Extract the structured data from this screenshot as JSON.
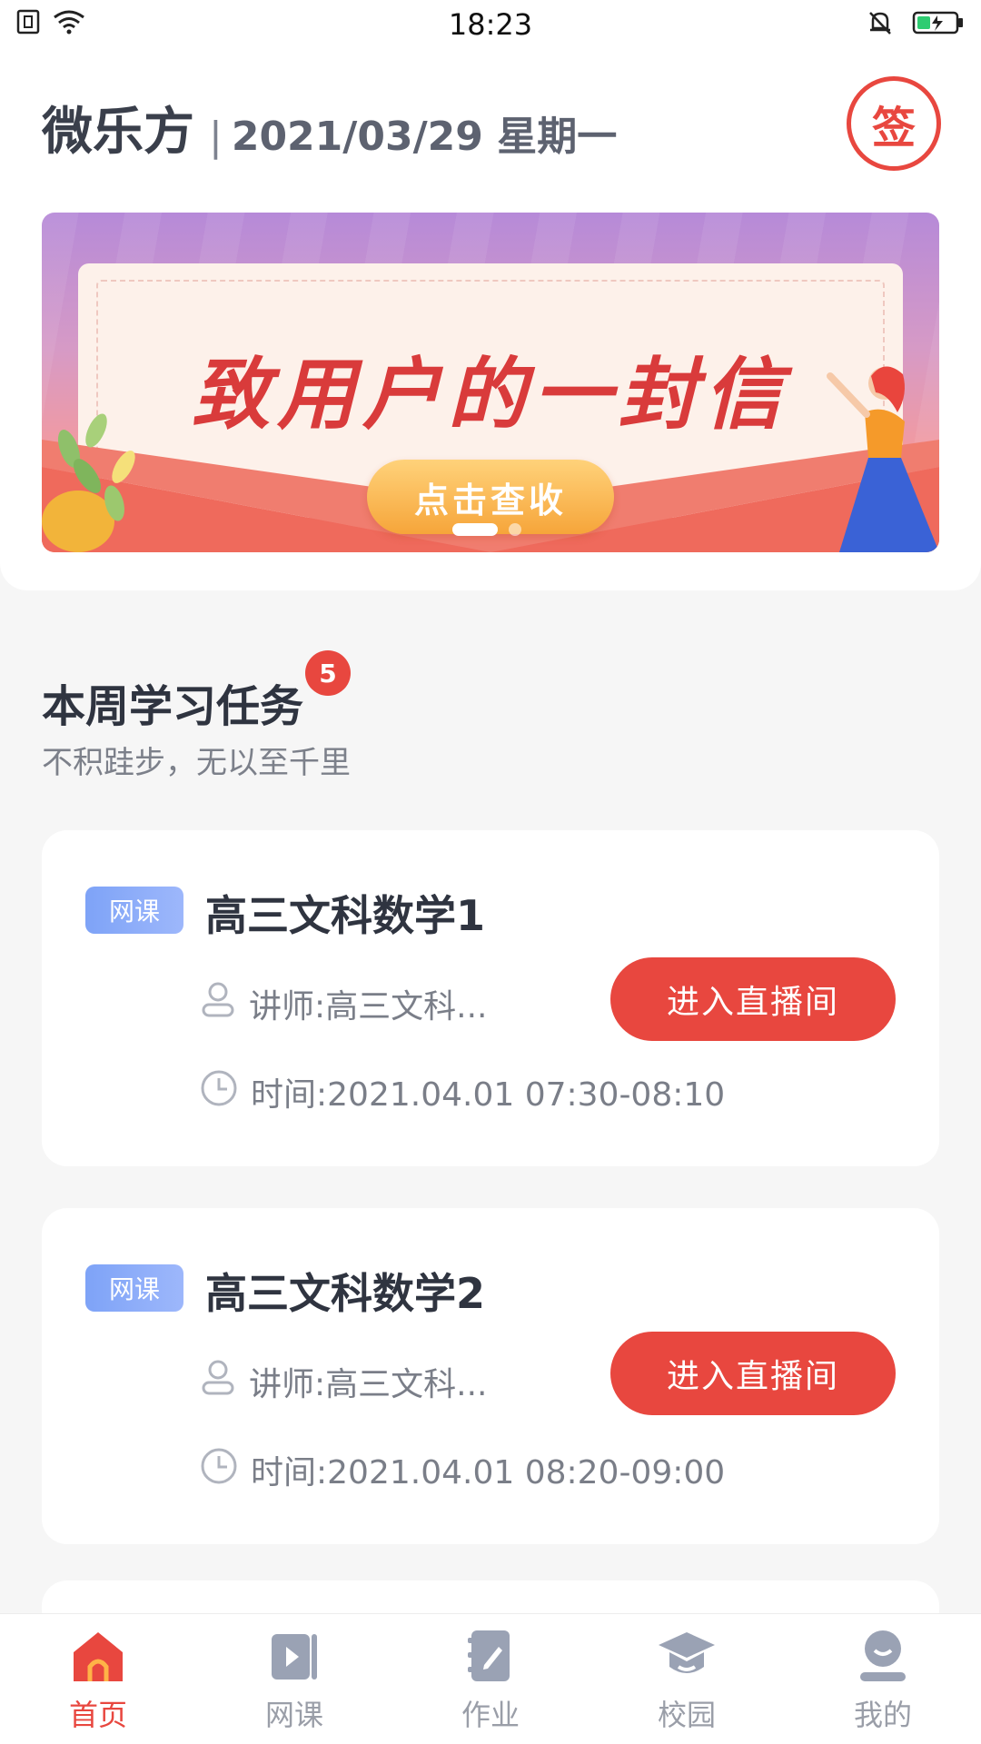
{
  "status_bar": {
    "time": "18:23"
  },
  "header": {
    "app_name": "微乐方",
    "separator": "|",
    "date": "2021/03/29 星期一",
    "sign_label": "签"
  },
  "banner": {
    "title": "致用户的一封信",
    "cta": "点击查收",
    "active_slide": 1,
    "slide_count": 2
  },
  "section": {
    "title": "本周学习任务",
    "badge_count": "5",
    "subtitle": "不积跬步，无以至千里"
  },
  "courses": [
    {
      "tag": "网课",
      "title": "高三文科数学1",
      "teacher": "讲师:高三文科...",
      "time": "时间:2021.04.01 07:30-08:10",
      "button": "进入直播间"
    },
    {
      "tag": "网课",
      "title": "高三文科数学2",
      "teacher": "讲师:高三文科...",
      "time": "时间:2021.04.01 08:20-09:00",
      "button": "进入直播间"
    }
  ],
  "bottom_nav": [
    {
      "label": "首页",
      "icon": "home-icon",
      "active": true
    },
    {
      "label": "网课",
      "icon": "video-course-icon",
      "active": false
    },
    {
      "label": "作业",
      "icon": "homework-icon",
      "active": false
    },
    {
      "label": "校园",
      "icon": "graduation-cap-icon",
      "active": false
    },
    {
      "label": "我的",
      "icon": "profile-icon",
      "active": false
    }
  ],
  "colors": {
    "accent": "#e8473f",
    "tag_blue": "#7ea3f7",
    "text_dark": "#2f3440",
    "text_muted": "#7a7e88",
    "background": "#f6f6f6"
  }
}
